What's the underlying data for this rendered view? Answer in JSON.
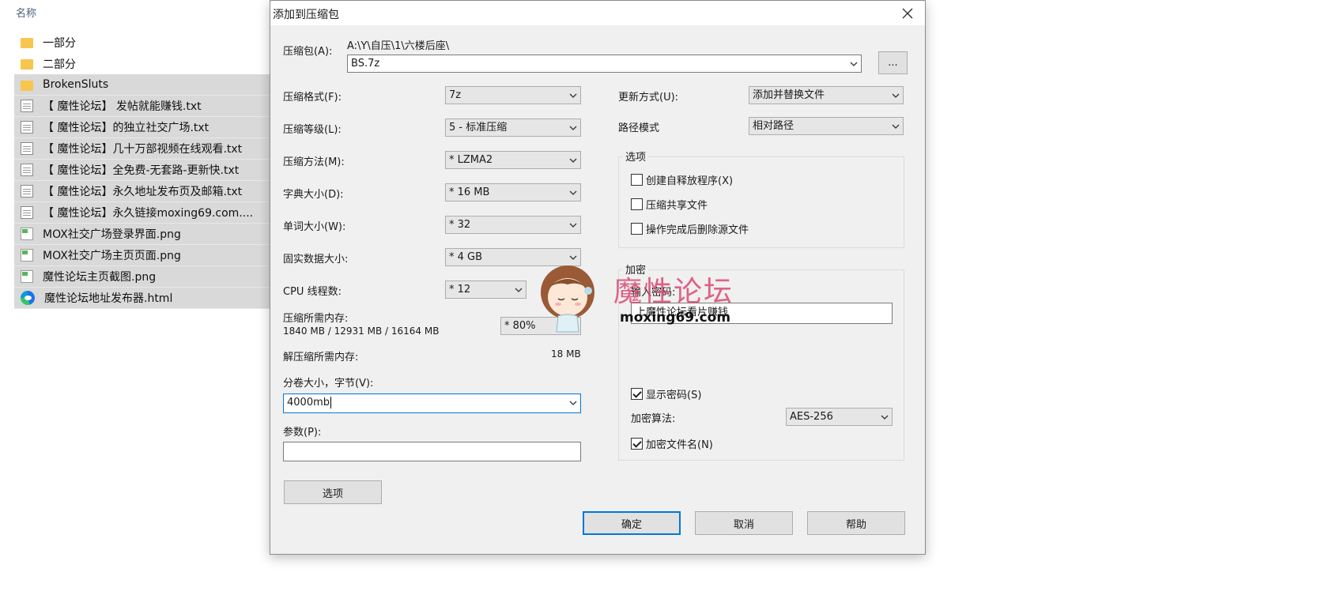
{
  "explorer": {
    "column_header": "名称",
    "files": [
      {
        "name": "一部分",
        "icon": "folder-icon",
        "selected": false
      },
      {
        "name": "二部分",
        "icon": "folder-icon",
        "selected": false
      },
      {
        "name": "BrokenSluts",
        "icon": "folder-icon",
        "selected": true
      },
      {
        "name": "【 魔性论坛】 发帖就能赚钱.txt",
        "icon": "text-file-icon",
        "selected": true
      },
      {
        "name": "【 魔性论坛】的独立社交广场.txt",
        "icon": "text-file-icon",
        "selected": true
      },
      {
        "name": "【 魔性论坛】几十万部视频在线观看.txt",
        "icon": "text-file-icon",
        "selected": true
      },
      {
        "name": "【 魔性论坛】全免费-无套路-更新快.txt",
        "icon": "text-file-icon",
        "selected": true
      },
      {
        "name": "【 魔性论坛】永久地址发布页及邮箱.txt",
        "icon": "text-file-icon",
        "selected": true
      },
      {
        "name": "【 魔性论坛】永久链接moxing69.com....",
        "icon": "text-file-icon",
        "selected": true
      },
      {
        "name": "MOX社交广场登录界面.png",
        "icon": "image-file-icon",
        "selected": true
      },
      {
        "name": "MOX社交广场主页页面.png",
        "icon": "image-file-icon",
        "selected": true
      },
      {
        "name": "魔性论坛主页截图.png",
        "icon": "image-file-icon",
        "selected": true
      },
      {
        "name": "魔性论坛地址发布器.html",
        "icon": "edge-browser-icon",
        "selected": true
      }
    ]
  },
  "dialog": {
    "title": "添加到压缩包",
    "archive_label": "压缩包(A):",
    "archive_path": "A:\\Y\\自压\\1\\六楼后座\\",
    "archive_name": "BS.7z",
    "browse_button": "...",
    "format_label": "压缩格式(F):",
    "format_value": "7z",
    "level_label": "压缩等级(L):",
    "level_value": "5 - 标准压缩",
    "method_label": "压缩方法(M):",
    "method_value": "* LZMA2",
    "dict_label": "字典大小(D):",
    "dict_value": "* 16 MB",
    "word_label": "单词大小(W):",
    "word_value": "* 32",
    "solid_label": "固实数据大小:",
    "solid_value": "* 4 GB",
    "cpu_label": "CPU 线程数:",
    "cpu_value": "* 12",
    "mem_compress_label": "压缩所需内存:",
    "mem_compress_value": "1840 MB / 12931 MB / 16164 MB",
    "mem_percent": "* 80%",
    "mem_decompress_label": "解压缩所需内存:",
    "mem_decompress_value": "18 MB",
    "volume_label": "分卷大小，字节(V):",
    "volume_value": "4000mb",
    "params_label": "参数(P):",
    "params_value": "",
    "options_button": "选项",
    "update_label": "更新方式(U):",
    "update_value": "添加并替换文件",
    "path_label": "路径模式",
    "path_value": "相对路径",
    "options_group": "选项",
    "opt_sfx": "创建自释放程序(X)",
    "opt_shared": "压缩共享文件",
    "opt_delete": "操作完成后删除源文件",
    "encrypt_group": "加密",
    "password_label": "输入密码:",
    "password_value": "上魔性论坛看片赚钱",
    "show_password": "显示密码(S)",
    "encrypt_method_label": "加密算法:",
    "encrypt_method_value": "AES-256",
    "encrypt_names": "加密文件名(N)",
    "ok_button": "确定",
    "cancel_button": "取消",
    "help_button": "帮助"
  },
  "watermark": {
    "text": "魔性论坛",
    "url": "moxing69.com"
  }
}
